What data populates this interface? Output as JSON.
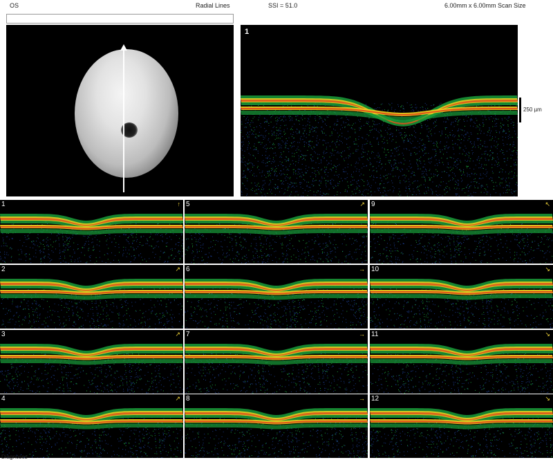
{
  "header": {
    "eye": "OS",
    "scan_type": "Radial Lines",
    "ssi": "SSI = 51.0",
    "scan_size": "6.00mm x 6.00mm Scan Size"
  },
  "main_scan": {
    "number": "1"
  },
  "scale": {
    "label": "250 µm"
  },
  "thumbnails": [
    {
      "number": "1",
      "arrow": "↑"
    },
    {
      "number": "5",
      "arrow": "↗"
    },
    {
      "number": "9",
      "arrow": "↖"
    },
    {
      "number": "2",
      "arrow": "↗"
    },
    {
      "number": "6",
      "arrow": "→"
    },
    {
      "number": "10",
      "arrow": "↘"
    },
    {
      "number": "3",
      "arrow": "↗"
    },
    {
      "number": "7",
      "arrow": "→"
    },
    {
      "number": "11",
      "arrow": "↘"
    },
    {
      "number": "4",
      "arrow": "↗"
    },
    {
      "number": "8",
      "arrow": "→"
    },
    {
      "number": "12",
      "arrow": "↘"
    }
  ],
  "footer": {
    "label": "Diagnoses"
  },
  "colors": {
    "retina_outer": "#1a9e3a",
    "retina_mid": "#f2d21e",
    "retina_hot": "#e43a1a",
    "noise": "#1a3a8a"
  }
}
